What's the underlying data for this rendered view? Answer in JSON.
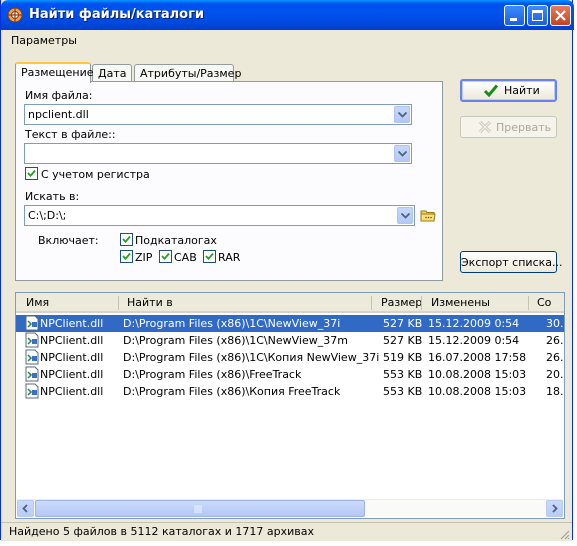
{
  "window": {
    "title": "Найти файлы/каталоги",
    "menu": [
      "Параметры"
    ]
  },
  "tabs": [
    "Размещение",
    "Дата",
    "Атрибуты/Размер"
  ],
  "form": {
    "filename_label": "Имя файла:",
    "filename_value": "npclient.dll",
    "text_label": "Текст в файле::",
    "text_value": "",
    "case_label": "С учетом регистра",
    "search_in_label": "Искать в:",
    "search_in_value": "C:\\;D:\\;",
    "includes_label": "Включает:",
    "subdirs_label": "Подкаталогах",
    "zip_label": "ZIP",
    "cab_label": "CAB",
    "rar_label": "RAR"
  },
  "buttons": {
    "find": "Найти",
    "stop": "Прервать",
    "export": "Экспорт списка..."
  },
  "results": {
    "columns": [
      "Имя",
      "Найти в",
      "Размер",
      "Изменены",
      "Со"
    ],
    "rows": [
      {
        "name": "NPClient.dll",
        "path": "D:\\Program Files (x86)\\1C\\NewView_37i",
        "size": "527 KB",
        "modified": "15.12.2009 0:54",
        "extra": "30."
      },
      {
        "name": "NPClient.dll",
        "path": "D:\\Program Files (x86)\\1C\\NewView_37m",
        "size": "527 KB",
        "modified": "15.12.2009 0:54",
        "extra": "26."
      },
      {
        "name": "NPClient.dll",
        "path": "D:\\Program Files (x86)\\1C\\Копия NewView_37i",
        "size": "519 KB",
        "modified": "16.07.2008 17:58",
        "extra": "26."
      },
      {
        "name": "NPClient.dll",
        "path": "D:\\Program Files (x86)\\FreeTrack",
        "size": "553 KB",
        "modified": "10.08.2008 15:03",
        "extra": "20."
      },
      {
        "name": "NPClient.dll",
        "path": "D:\\Program Files (x86)\\Копия FreeTrack",
        "size": "553 KB",
        "modified": "10.08.2008 15:03",
        "extra": "18."
      }
    ],
    "selected_index": 0
  },
  "status": "Найдено 5 файлов в 5112 каталогах и 1717 архивах",
  "colors": {
    "titlebar": "#0053ee",
    "face": "#ece9d8",
    "selection": "#316ac5",
    "tab_highlight": "#ffc83c"
  }
}
